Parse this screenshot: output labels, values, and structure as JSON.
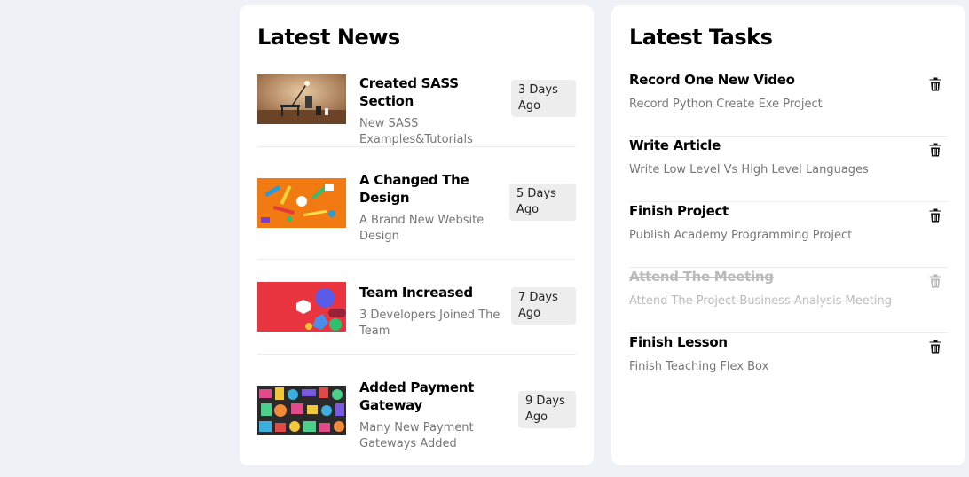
{
  "news": {
    "title": "Latest News",
    "items": [
      {
        "title": "Created SASS Section",
        "description": "New SASS Examples&Tutorials",
        "age": "3 Days Ago",
        "thumbnail": "desk-lamp-photo"
      },
      {
        "title": "A Changed The Design",
        "description": "A Brand New Website Design",
        "age": "5 Days Ago",
        "thumbnail": "orange-stationery-photo"
      },
      {
        "title": "Team Increased",
        "description": "3 Developers Joined The Team",
        "age": "7 Days Ago",
        "thumbnail": "red-abstract-shapes-photo"
      },
      {
        "title": "Added Payment Gateway",
        "description": "Many New Payment Gateways Added",
        "age": "9 Days Ago",
        "thumbnail": "colorful-doodle-pattern"
      }
    ]
  },
  "tasks": {
    "title": "Latest Tasks",
    "items": [
      {
        "title": "Record One New Video",
        "description": "Record Python Create Exe Project",
        "done": false,
        "icon": "trash-icon"
      },
      {
        "title": "Write Article",
        "description": "Write Low Level Vs High Level Languages",
        "done": false,
        "icon": "trash-icon"
      },
      {
        "title": "Finish Project",
        "description": "Publish Academy Programming Project",
        "done": false,
        "icon": "trash-icon"
      },
      {
        "title": "Attend The Meeting",
        "description": "Attend The Project Business Analysis Meeting",
        "done": true,
        "icon": "trash-icon"
      },
      {
        "title": "Finish Lesson",
        "description": "Finish Teaching Flex Box",
        "done": false,
        "icon": "trash-icon"
      }
    ]
  },
  "colors": {
    "page_background": "#eef1f5",
    "panel_background": "#ffffff",
    "badge_background": "#ededed",
    "muted_text": "#777777"
  }
}
